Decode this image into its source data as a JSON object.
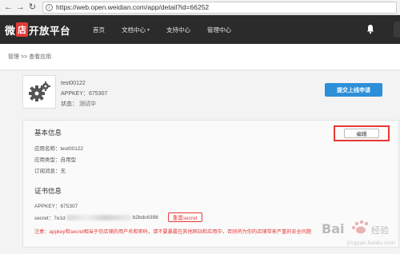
{
  "browser": {
    "url": "https://web.open.weidian.com/app/detail?id=66252"
  },
  "topnav": {
    "logo_left": "微",
    "logo_badge": "店",
    "logo_right": "开放平台",
    "menu": [
      {
        "label": "首页"
      },
      {
        "label": "文档中心"
      },
      {
        "label": "支持中心"
      },
      {
        "label": "管理中心"
      }
    ]
  },
  "breadcrumb": {
    "text": "管理 >> 查看应用"
  },
  "app": {
    "name": "test00122",
    "appkey": "APPKEY：675307",
    "status": "状态：",
    "status_value": "测试中",
    "submit_label": "提交上线申请"
  },
  "basic": {
    "title": "基本信息",
    "app_name": "应用名称：test00122",
    "app_type": "应用类型：自用型",
    "subscription": "订阅消息：无",
    "edit_label": "编辑"
  },
  "cert": {
    "title": "证书信息",
    "appkey": "APPKEY：675307",
    "secret_prefix": "secret：7e1d",
    "secret_suffix": "b2bdc6398",
    "reset_label": "重置secret",
    "notice": "注意：appkey和secret相当于你店铺的用户名和密码，请不要暴露在其他网站和应用中，否则将为你的店铺带来严重的安全问题"
  },
  "watermark": {
    "text": "Bai 经验",
    "url": "jingyan.baidu.com"
  }
}
